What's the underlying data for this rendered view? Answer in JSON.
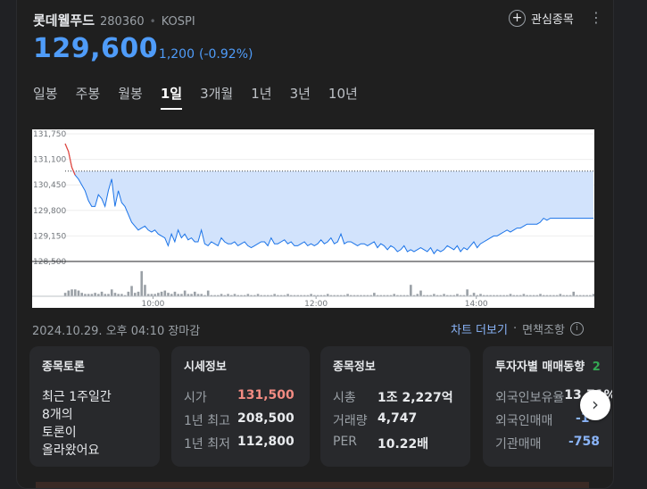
{
  "stock": {
    "name": "롯데웰푸드",
    "code": "280360",
    "market": "KOSPI",
    "price": "129,600",
    "change": "1,200",
    "change_pct": "(-0.92%)",
    "change_color": "#4f9cf9"
  },
  "watch_label": "관심종목",
  "tabs": [
    "일봉",
    "주봉",
    "월봉",
    "1일",
    "3개월",
    "1년",
    "3년",
    "10년"
  ],
  "active_tab": "1일",
  "timestamp": "2024.10.29. 오후 04:10 장마감",
  "links": {
    "chart_more": "차트 더보기",
    "disclaimer": "면책조항"
  },
  "chart_data": {
    "type": "line",
    "y_ticks": [
      "131,750",
      "131,100",
      "130,450",
      "129,800",
      "129,150",
      "128,500"
    ],
    "y_values": [
      131750,
      131100,
      130450,
      129800,
      129150,
      128500
    ],
    "x_ticks": [
      "10:00",
      "12:00",
      "14:00"
    ],
    "prev_close": 130800,
    "ylim": [
      128500,
      131750
    ],
    "open": 131500,
    "close": 129600,
    "line_color": "#1a73e8",
    "fill_color": "#d2e3fc",
    "series": [
      131500,
      131300,
      130900,
      130700,
      130600,
      130450,
      130300,
      130050,
      129900,
      129900,
      130200,
      130100,
      129900,
      130300,
      130600,
      129900,
      130300,
      130000,
      129900,
      129700,
      129500,
      129400,
      129300,
      129350,
      129400,
      129300,
      129250,
      129300,
      129200,
      129150,
      129100,
      128900,
      129200,
      129000,
      129300,
      129100,
      129200,
      129050,
      129100,
      129000,
      129000,
      129300,
      128950,
      128900,
      129000,
      128950,
      128900,
      129100,
      129000,
      128950,
      128950,
      129000,
      128900,
      128950,
      129000,
      128900,
      128850,
      128900,
      128950,
      129000,
      129000,
      128900,
      129100,
      128950,
      128950,
      129000,
      129050,
      128950,
      129000,
      128900,
      128900,
      128950,
      129000,
      128900,
      128950,
      128900,
      128950,
      129050,
      128950,
      129000,
      129100,
      128950,
      129000,
      129200,
      128950,
      129000,
      129000,
      128950,
      128900,
      128950,
      128950,
      128900,
      128950,
      129000,
      128850,
      128950,
      128900,
      128800,
      128900,
      128850,
      128750,
      128800,
      128900,
      128750,
      128800,
      128750,
      128800,
      128850,
      128800,
      128750,
      128850,
      128700,
      128800,
      128750,
      128800,
      128900,
      128850,
      128800,
      128900,
      128750,
      128850,
      128800,
      128900,
      129000,
      128850,
      128950,
      129000,
      129050,
      129100,
      129150,
      129150,
      129200,
      129250,
      129300,
      129250,
      129300,
      129350,
      129350,
      129400,
      129450,
      129450,
      129450,
      129450,
      129500,
      129600,
      129550,
      129600,
      129600,
      129600,
      129600,
      129600,
      129600,
      129600,
      129600,
      129600,
      129600,
      129600,
      129600,
      129600,
      129600
    ],
    "volume": [
      3,
      5,
      6,
      6,
      5,
      3,
      2,
      2,
      2,
      3,
      2,
      4,
      2,
      2,
      6,
      3,
      2,
      2,
      1,
      4,
      9,
      3,
      4,
      22,
      10,
      2,
      2,
      2,
      3,
      4,
      5,
      3,
      2,
      4,
      2,
      2,
      5,
      2,
      2,
      4,
      2,
      2,
      1,
      5,
      1,
      1,
      1,
      2,
      1,
      2,
      1,
      2,
      1,
      1,
      1,
      2,
      1,
      1,
      2,
      1,
      1,
      1,
      1,
      2,
      1,
      1,
      1,
      2,
      1,
      1,
      1,
      1,
      1,
      1,
      2,
      1,
      1,
      1,
      1,
      2,
      1,
      1,
      1,
      1,
      1,
      2,
      1,
      1,
      1,
      1,
      1,
      1,
      1,
      3,
      1,
      1,
      1,
      1,
      1,
      2,
      1,
      1,
      1,
      1,
      10,
      1,
      2,
      5,
      1,
      1,
      1,
      2,
      1,
      1,
      2,
      1,
      1,
      1,
      2,
      1,
      1,
      6,
      1,
      3,
      1,
      2,
      1,
      1,
      1,
      1,
      1,
      1,
      1,
      1,
      2,
      1,
      1,
      1,
      2,
      1,
      1,
      1,
      1,
      2,
      1,
      1,
      1,
      1,
      1,
      2,
      1,
      1,
      1,
      4,
      1,
      1,
      1,
      1,
      1,
      2
    ]
  },
  "panels": {
    "talk": {
      "title": "종목토론",
      "lines": [
        "최근 1주일간",
        "8개의",
        "토론이",
        "올라왔어요"
      ]
    },
    "quote": {
      "title": "시세정보",
      "rows": [
        {
          "k": "시가",
          "v": "131,500",
          "color": "#f28b82"
        },
        {
          "k": "1년 최고",
          "v": "208,500",
          "color": ""
        },
        {
          "k": "1년 최저",
          "v": "112,800",
          "color": ""
        }
      ]
    },
    "info": {
      "title": "종목정보",
      "rows": [
        {
          "k": "시총",
          "v": "1조 2,227억"
        },
        {
          "k": "거래량",
          "v": "4,747"
        },
        {
          "k": "PER",
          "v": "10.22배"
        }
      ]
    },
    "investor": {
      "title": "투자자별 매매동향",
      "badge": "2",
      "rows": [
        {
          "k": "외국인보유율",
          "v": "13.71%"
        },
        {
          "k": "외국인매매",
          "v": "-1"
        },
        {
          "k": "기관매매",
          "v": "-758"
        }
      ]
    }
  }
}
